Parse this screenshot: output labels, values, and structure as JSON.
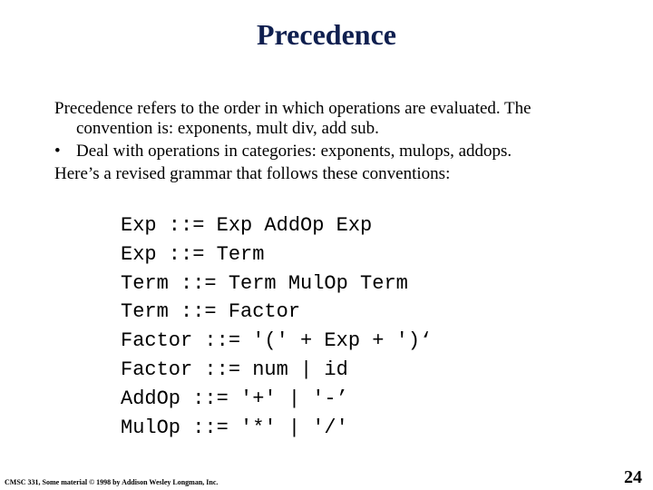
{
  "slide": {
    "title": "Precedence",
    "body": {
      "line1": "Precedence refers to the order in which operations are evaluated.  The",
      "line1_cont": "convention is: exponents, mult div, add sub.",
      "bullet_glyph": "•",
      "bullet_text": "Deal with operations in categories: exponents, mulops, addops.",
      "line3": "Here’s a revised grammar that follows these conventions:"
    },
    "grammar": [
      "Exp ::= Exp AddOp Exp",
      "Exp ::= Term",
      "Term ::= Term MulOp Term",
      "Term ::= Factor",
      "Factor ::= '(' + Exp + ')‘",
      "Factor ::= num | id",
      "AddOp ::= '+' | '-’",
      "MulOp ::= '*' | '/'"
    ],
    "footer": "CMSC 331, Some material © 1998 by Addison Wesley Longman, Inc.",
    "page_number": "24"
  }
}
